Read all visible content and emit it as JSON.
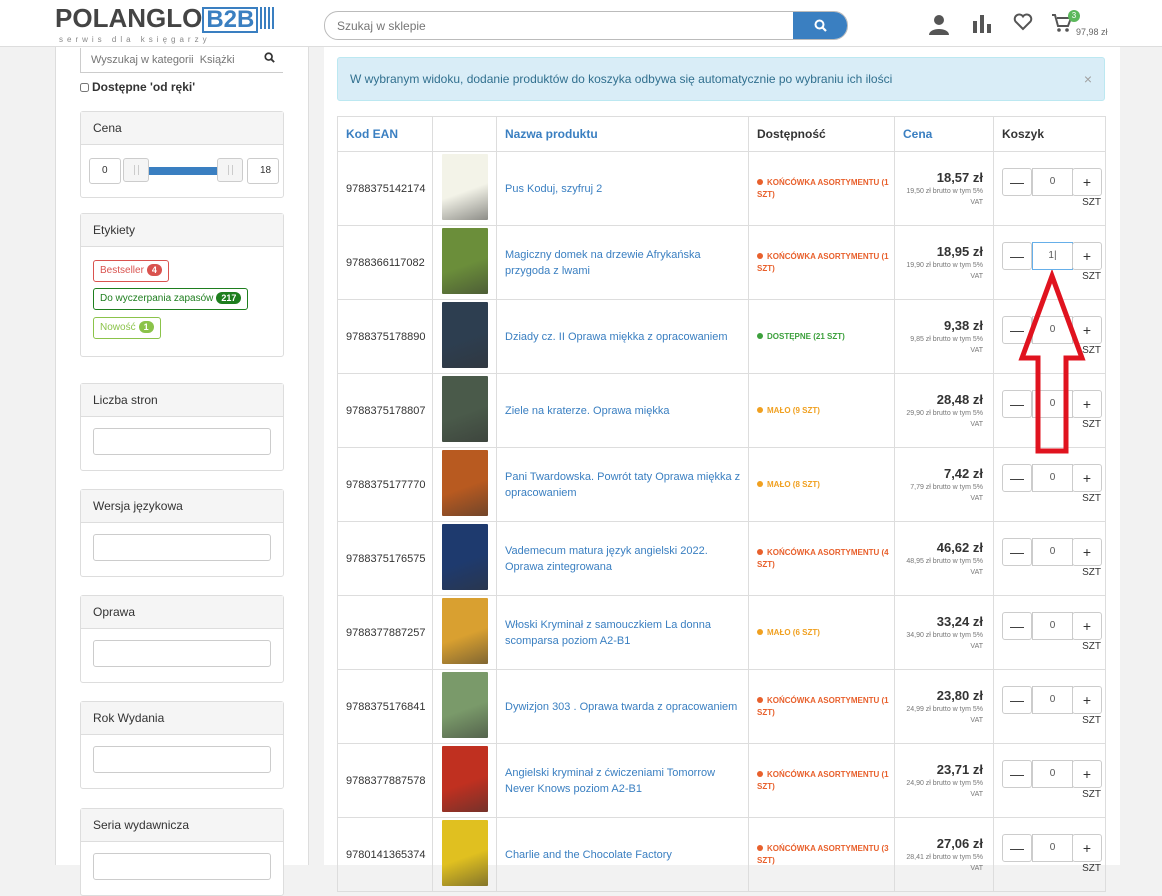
{
  "header": {
    "logo_main": "POLANGLO",
    "logo_b2b": "B2B",
    "logo_tagline": "serwis dla księgarzy",
    "search_placeholder": "Szukaj w sklepie",
    "cart_count": "3",
    "cart_total": "97,98 zł"
  },
  "sidebar": {
    "category_search_placeholder": "Wyszukaj w kategorii  Książki",
    "available_label": "Dostępne 'od ręki'",
    "price_panel": {
      "title": "Cena",
      "min": "0",
      "max": "18"
    },
    "labels_panel": {
      "title": "Etykiety",
      "tags": [
        {
          "label": "Bestseller",
          "count": "4",
          "color": "#d9534f"
        },
        {
          "label": "Do wyczerpania zapasów",
          "count": "217",
          "color": "#1e7e1e"
        },
        {
          "label": "Nowość",
          "count": "1",
          "color": "#8bc34a"
        }
      ]
    },
    "filters": [
      {
        "title": "Liczba stron"
      },
      {
        "title": "Wersja językowa"
      },
      {
        "title": "Oprawa"
      },
      {
        "title": "Rok Wydania"
      },
      {
        "title": "Seria wydawnicza"
      }
    ]
  },
  "main": {
    "alert": "W wybranym widoku, dodanie produktów do koszyka odbywa się automatycznie po wybraniu ich ilości",
    "alert_close": "×",
    "columns": {
      "ean": "Kod EAN",
      "name": "Nazwa produktu",
      "availability": "Dostępność",
      "price": "Cena",
      "cart": "Koszyk"
    },
    "unit": "SZT",
    "minus": "—",
    "plus": "+",
    "products": [
      {
        "ean": "9788375142174",
        "name": "Pus Koduj, szyfruj 2",
        "avail": "KOŃCÓWKA ASORTYMENTU (1 SZT)",
        "avail_color": "#e8602c",
        "price": "18,57 zł",
        "gross": "19,50 zł brutto w tym 5% VAT",
        "qty": "0",
        "cover": "#f3f3e8"
      },
      {
        "ean": "9788366117082",
        "name": "Magiczny domek na drzewie Afrykańska przygoda z lwami",
        "avail": "KOŃCÓWKA ASORTYMENTU (1 SZT)",
        "avail_color": "#e8602c",
        "price": "18,95 zł",
        "gross": "19,90 zł brutto w tym 5% VAT",
        "qty": "1|",
        "cover": "#6b8e3a"
      },
      {
        "ean": "9788375178890",
        "name": "Dziady cz. II Oprawa miękka z opracowaniem",
        "avail": "DOSTĘPNE (21 SZT)",
        "avail_color": "#3ca03c",
        "price": "9,38 zł",
        "gross": "9,85 zł brutto w tym 5% VAT",
        "qty": "0",
        "cover": "#2d3e50"
      },
      {
        "ean": "9788375178807",
        "name": "Ziele na kraterze. Oprawa miękka",
        "avail": "MAŁO (9 SZT)",
        "avail_color": "#f0a020",
        "price": "28,48 zł",
        "gross": "29,90 zł brutto w tym 5% VAT",
        "qty": "0",
        "cover": "#4a5a4a"
      },
      {
        "ean": "9788375177770",
        "name": "Pani Twardowska. Powrót taty Oprawa miękka z opracowaniem",
        "avail": "MAŁO (8 SZT)",
        "avail_color": "#f0a020",
        "price": "7,42 zł",
        "gross": "7,79 zł brutto w tym 5% VAT",
        "qty": "0",
        "cover": "#b85a20"
      },
      {
        "ean": "9788375176575",
        "name": "Vademecum matura język angielski 2022. Oprawa zintegrowana",
        "avail": "KOŃCÓWKA ASORTYMENTU (4 SZT)",
        "avail_color": "#e8602c",
        "price": "46,62 zł",
        "gross": "48,95 zł brutto w tym 5% VAT",
        "qty": "0",
        "cover": "#1e3a6e"
      },
      {
        "ean": "9788377887257",
        "name": "Włoski Kryminał z samouczkiem La donna scomparsa poziom A2-B1",
        "avail": "MAŁO (6 SZT)",
        "avail_color": "#f0a020",
        "price": "33,24 zł",
        "gross": "34,90 zł brutto w tym 5% VAT",
        "qty": "0",
        "cover": "#d9a030"
      },
      {
        "ean": "9788375176841",
        "name": "Dywizjon 303 . Oprawa twarda z opracowaniem",
        "avail": "KOŃCÓWKA ASORTYMENTU (1 SZT)",
        "avail_color": "#e8602c",
        "price": "23,80 zł",
        "gross": "24,99 zł brutto w tym 5% VAT",
        "qty": "0",
        "cover": "#7a9a6a"
      },
      {
        "ean": "9788377887578",
        "name": "Angielski kryminał z ćwiczeniami Tomorrow Never Knows poziom A2-B1",
        "avail": "KOŃCÓWKA ASORTYMENTU (1 SZT)",
        "avail_color": "#e8602c",
        "price": "23,71 zł",
        "gross": "24,90 zł brutto w tym 5% VAT",
        "qty": "0",
        "cover": "#c03020"
      },
      {
        "ean": "9780141365374",
        "name": "Charlie and the Chocolate Factory",
        "avail": "KOŃCÓWKA ASORTYMENTU (3 SZT)",
        "avail_color": "#e8602c",
        "price": "27,06 zł",
        "gross": "28,41 zł brutto w tym 5% VAT",
        "qty": "0",
        "cover": "#e0c020"
      }
    ]
  },
  "colors": {
    "accent": "#3a7fc1",
    "alert_bg": "#d9edf7",
    "arrow": "#e0131f"
  }
}
